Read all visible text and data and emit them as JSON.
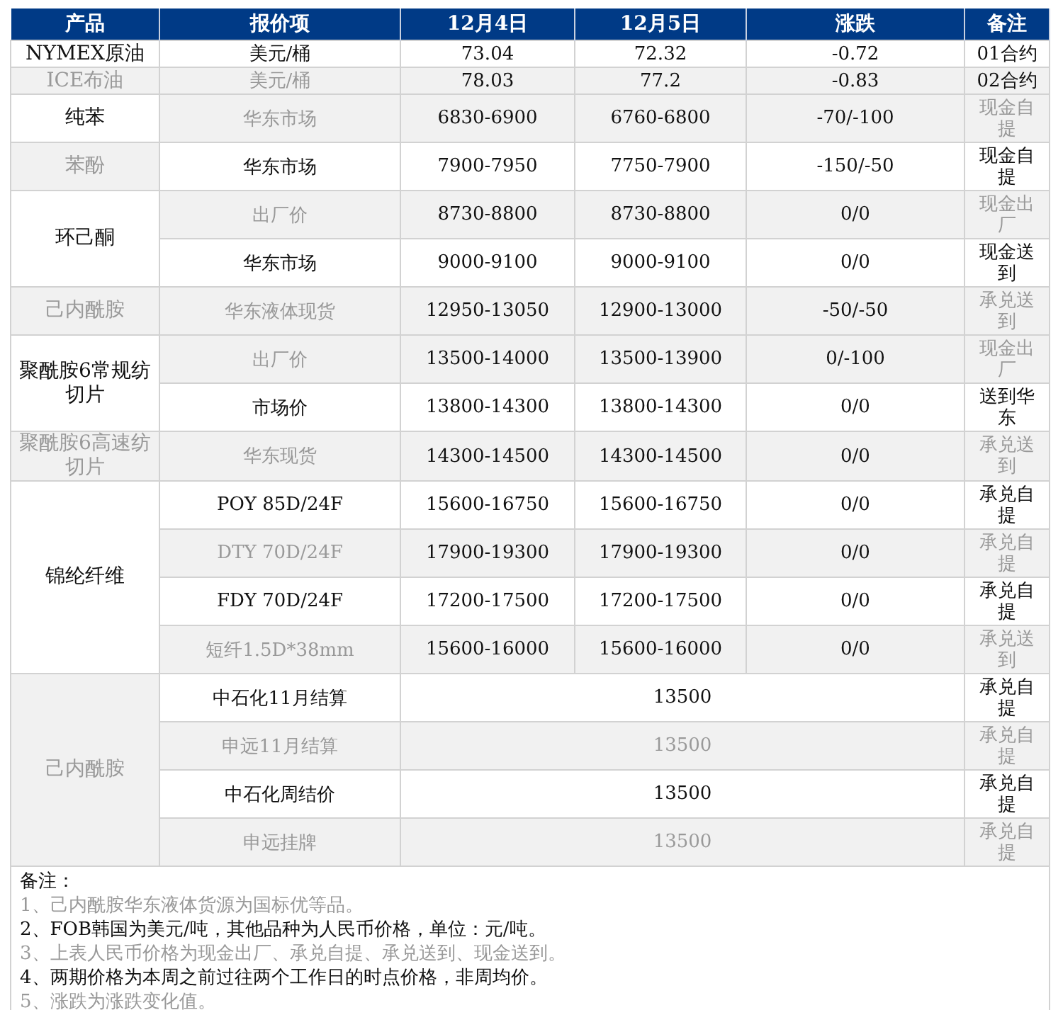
{
  "table": {
    "columns": [
      "产品",
      "报价项",
      "12月4日",
      "12月5日",
      "涨跌",
      "备注"
    ],
    "groups": [
      {
        "product": "NYMEX原油",
        "muted": false,
        "shaded": false,
        "rows": [
          {
            "kind": "quote",
            "item": "美元/桶",
            "item_muted": false,
            "d1": "73.04",
            "d2": "72.32",
            "change": "-0.72",
            "note": "01合约",
            "note_muted": false,
            "shaded": false
          }
        ]
      },
      {
        "product": "ICE布油",
        "muted": true,
        "shaded": true,
        "rows": [
          {
            "kind": "quote",
            "item": "美元/桶",
            "item_muted": true,
            "d1": "78.03",
            "d2": "77.2",
            "change": "-0.83",
            "note": "02合约",
            "note_muted": false,
            "shaded": true
          }
        ]
      },
      {
        "product": "纯苯",
        "muted": false,
        "shaded": false,
        "rows": [
          {
            "kind": "quote",
            "item": "华东市场",
            "item_muted": true,
            "d1": "6830-6900",
            "d2": "6760-6800",
            "change": "-70/-100",
            "note": "现金自提",
            "note_muted": true,
            "shaded": true
          }
        ]
      },
      {
        "product": "苯酚",
        "muted": true,
        "shaded": true,
        "rows": [
          {
            "kind": "quote",
            "item": "华东市场",
            "item_muted": false,
            "d1": "7900-7950",
            "d2": "7750-7900",
            "change": "-150/-50",
            "note": "现金自提",
            "note_muted": false,
            "shaded": false
          }
        ]
      },
      {
        "product": "环己酮",
        "muted": false,
        "shaded": false,
        "rows": [
          {
            "kind": "quote",
            "item": "出厂价",
            "item_muted": true,
            "d1": "8730-8800",
            "d2": "8730-8800",
            "change": "0/0",
            "note": "现金出厂",
            "note_muted": true,
            "shaded": true
          },
          {
            "kind": "quote",
            "item": "华东市场",
            "item_muted": false,
            "d1": "9000-9100",
            "d2": "9000-9100",
            "change": "0/0",
            "note": "现金送到",
            "note_muted": false,
            "shaded": false
          }
        ]
      },
      {
        "product": "己内酰胺",
        "muted": true,
        "shaded": true,
        "rows": [
          {
            "kind": "quote",
            "item": "华东液体现货",
            "item_muted": true,
            "d1": "12950-13050",
            "d2": "12900-13000",
            "change": "-50/-50",
            "note": "承兑送到",
            "note_muted": true,
            "shaded": true
          }
        ]
      },
      {
        "product": "聚酰胺6常规纺切片",
        "muted": false,
        "shaded": false,
        "rows": [
          {
            "kind": "quote",
            "item": "出厂价",
            "item_muted": true,
            "d1": "13500-14000",
            "d2": "13500-13900",
            "change": "0/-100",
            "note": "现金出厂",
            "note_muted": true,
            "shaded": true
          },
          {
            "kind": "quote",
            "item": "市场价",
            "item_muted": false,
            "d1": "13800-14300",
            "d2": "13800-14300",
            "change": "0/0",
            "note": "送到华东",
            "note_muted": false,
            "shaded": false
          }
        ]
      },
      {
        "product": "聚酰胺6高速纺切片",
        "muted": true,
        "shaded": true,
        "rows": [
          {
            "kind": "quote",
            "item": "华东现货",
            "item_muted": true,
            "d1": "14300-14500",
            "d2": "14300-14500",
            "change": "0/0",
            "note": "承兑送到",
            "note_muted": true,
            "shaded": true
          }
        ]
      },
      {
        "product": "锦纶纤维",
        "muted": false,
        "shaded": false,
        "rows": [
          {
            "kind": "quote",
            "item": "POY 85D/24F",
            "item_muted": false,
            "d1": "15600-16750",
            "d2": "15600-16750",
            "change": "0/0",
            "note": "承兑自提",
            "note_muted": false,
            "shaded": false
          },
          {
            "kind": "quote",
            "item": "DTY 70D/24F",
            "item_muted": true,
            "d1": "17900-19300",
            "d2": "17900-19300",
            "change": "0/0",
            "note": "承兑自提",
            "note_muted": true,
            "shaded": true
          },
          {
            "kind": "quote",
            "item": "FDY 70D/24F",
            "item_muted": false,
            "d1": "17200-17500",
            "d2": "17200-17500",
            "change": "0/0",
            "note": "承兑自提",
            "note_muted": false,
            "shaded": false
          },
          {
            "kind": "quote",
            "item": "短纤1.5D*38mm",
            "item_muted": true,
            "d1": "15600-16000",
            "d2": "15600-16000",
            "change": "0/0",
            "note": "承兑送到",
            "note_muted": true,
            "shaded": true
          }
        ]
      },
      {
        "product": "己内酰胺",
        "muted": true,
        "shaded": true,
        "rows": [
          {
            "kind": "merged",
            "item": "中石化11月结算",
            "item_muted": false,
            "value": "13500",
            "note": "承兑自提",
            "note_muted": false,
            "shaded": false
          },
          {
            "kind": "merged",
            "item": "申远11月结算",
            "item_muted": true,
            "value": "13500",
            "note": "承兑自提",
            "note_muted": true,
            "shaded": true
          },
          {
            "kind": "merged",
            "item": "中石化周结价",
            "item_muted": false,
            "value": "13500",
            "note": "承兑自提",
            "note_muted": false,
            "shaded": false
          },
          {
            "kind": "merged",
            "item": "申远挂牌",
            "item_muted": true,
            "value": "13500",
            "note": "承兑自提",
            "note_muted": true,
            "shaded": true
          }
        ]
      }
    ]
  },
  "notes": {
    "title": "备注：",
    "lines": [
      {
        "text": "1、己内酰胺华东液体货源为国标优等品。",
        "muted": true
      },
      {
        "text": "2、FOB韩国为美元/吨，其他品种为人民币价格，单位：元/吨。",
        "muted": false
      },
      {
        "text": "3、上表人民币价格为现金出厂、承兑自提、承兑送到、现金送到。",
        "muted": true
      },
      {
        "text": "4、两期价格为本周之前过往两个工作日的时点价格，非周均价。",
        "muted": false
      },
      {
        "text": "5、涨跌为涨跌变化值。",
        "muted": true
      }
    ]
  }
}
